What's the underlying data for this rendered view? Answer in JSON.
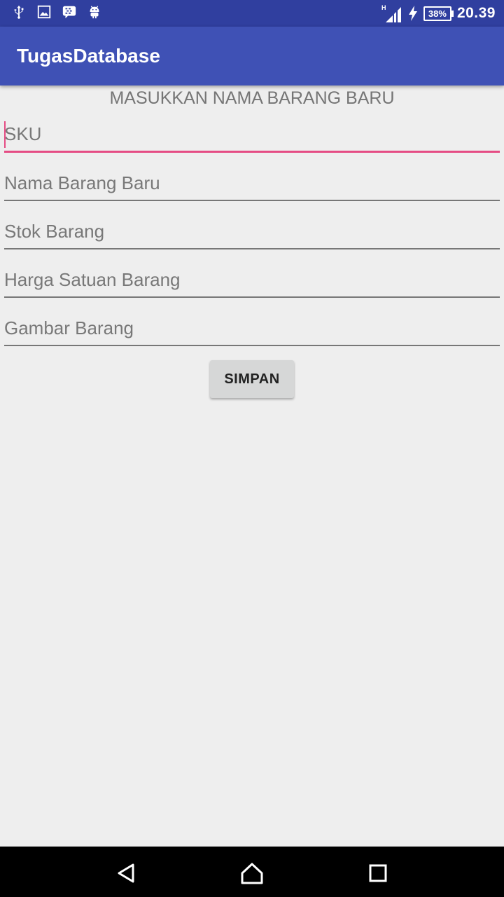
{
  "status_bar": {
    "time": "20.39",
    "battery": "38%",
    "network_label": "H",
    "icons": [
      "usb-icon",
      "image-icon",
      "bbm-icon",
      "android-icon",
      "signal-icon",
      "charging-icon",
      "battery-icon"
    ]
  },
  "app_bar": {
    "title": "TugasDatabase"
  },
  "form": {
    "heading": "MASUKKAN NAMA BARANG BARU",
    "fields": [
      {
        "placeholder": "SKU",
        "value": ""
      },
      {
        "placeholder": "Nama Barang Baru",
        "value": ""
      },
      {
        "placeholder": "Stok Barang",
        "value": ""
      },
      {
        "placeholder": "Harga Satuan Barang",
        "value": ""
      },
      {
        "placeholder": "Gambar Barang",
        "value": ""
      }
    ],
    "submit_label": "SIMPAN"
  },
  "colors": {
    "status_bar": "#303f9f",
    "app_bar": "#3f51b5",
    "accent": "#e54c84",
    "background": "#eeeeee"
  },
  "nav_bar": {
    "buttons": [
      "back-icon",
      "home-icon",
      "recents-icon"
    ]
  }
}
